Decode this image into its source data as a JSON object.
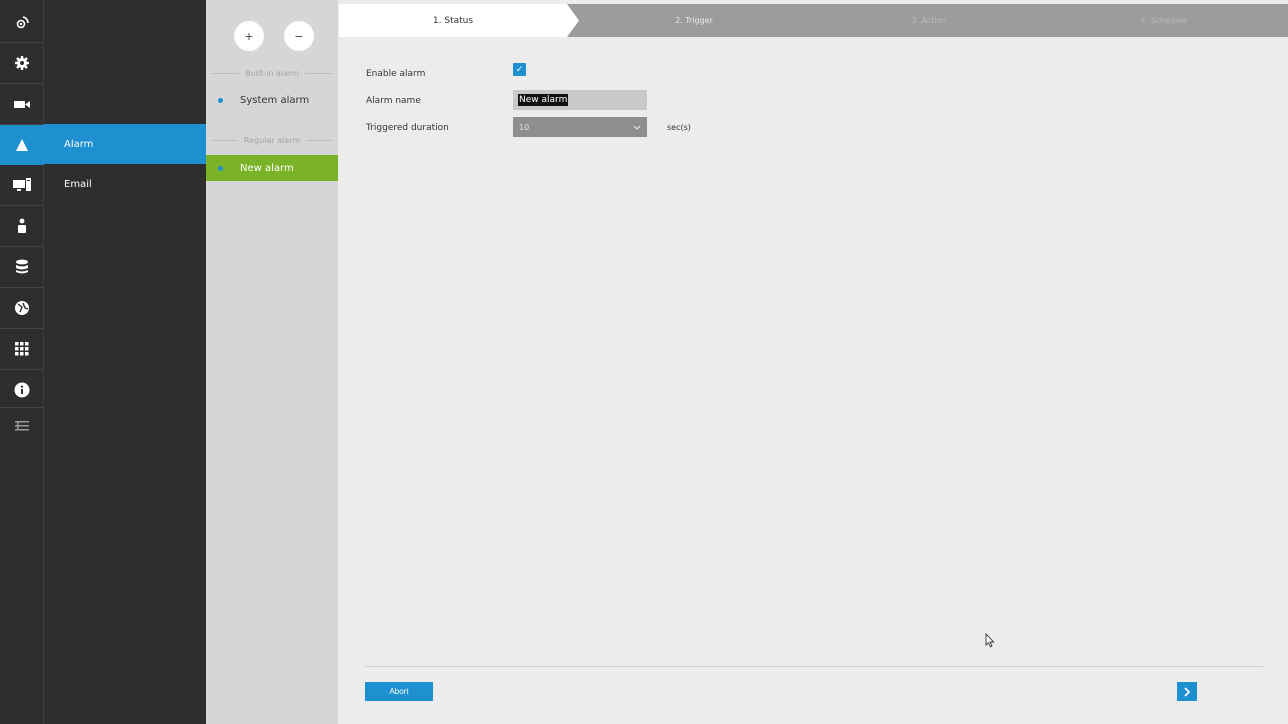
{
  "rail": {
    "items": [
      {
        "icon": "camera-view-icon"
      },
      {
        "icon": "gear-icon"
      },
      {
        "icon": "video-camera-icon"
      },
      {
        "icon": "alarm-icon",
        "active": true
      },
      {
        "icon": "monitor-icon"
      },
      {
        "icon": "user-icon"
      },
      {
        "icon": "database-icon"
      },
      {
        "icon": "network-icon"
      },
      {
        "icon": "apps-grid-icon"
      },
      {
        "icon": "info-icon"
      },
      {
        "icon": "menu-lines-icon"
      }
    ]
  },
  "subnav": {
    "items": [
      {
        "label": "Alarm",
        "active": true
      },
      {
        "label": "Email"
      }
    ]
  },
  "alarm_list": {
    "add_label": "+",
    "remove_label": "−",
    "builtin_section": "Built-in alarm",
    "builtin_items": [
      "System alarm"
    ],
    "regular_section": "Regular alarm",
    "regular_items": [
      "New alarm"
    ]
  },
  "wizard": {
    "steps": [
      "1. Status",
      "2. Trigger",
      "3. Action",
      "4. Schedule"
    ],
    "active_step": "1. Status"
  },
  "form": {
    "enable_label": "Enable alarm",
    "enable_checked": true,
    "name_label": "Alarm name",
    "name_value": "New alarm",
    "duration_label": "Triggered duration",
    "duration_value": "10",
    "duration_unit": "sec(s)"
  },
  "footer": {
    "abort_label": "Abort",
    "next_icon": "chevron-right-icon"
  },
  "colors": {
    "accent": "#1e8fcf",
    "active_alarm": "#7ab327",
    "sidebar": "#2e2e2e"
  }
}
